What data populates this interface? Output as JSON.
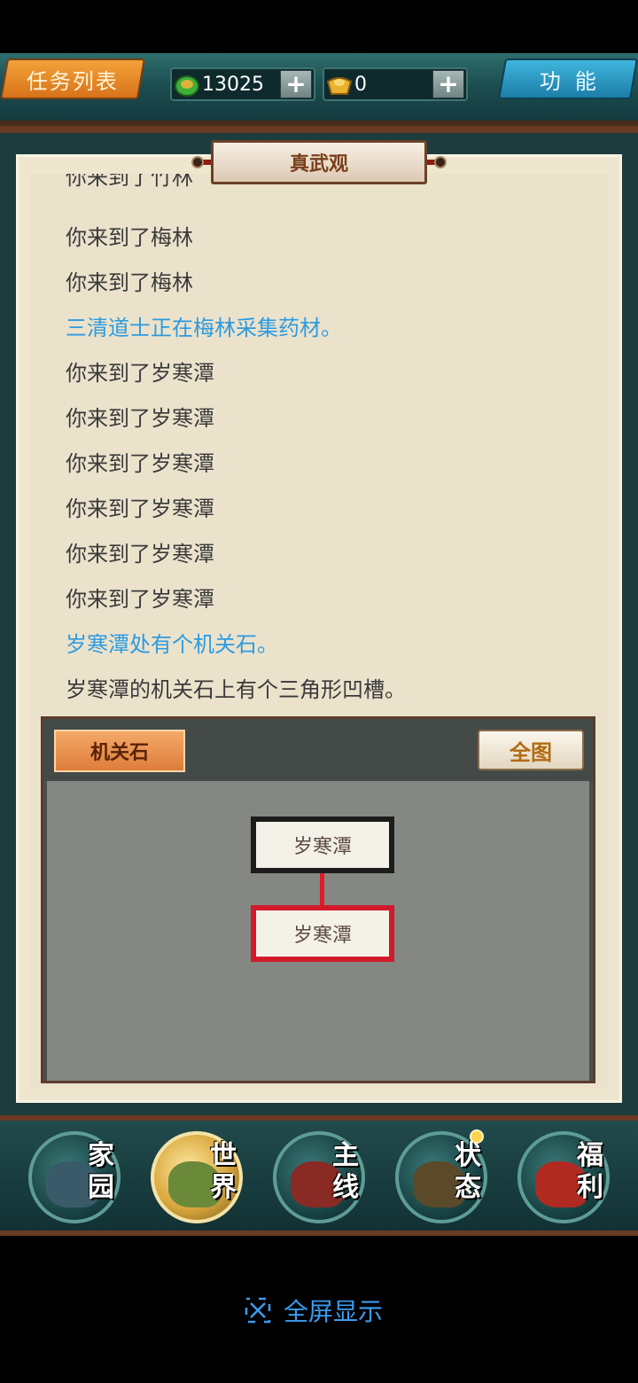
{
  "topbar": {
    "task_label": "任务列表",
    "gold_value": "13025",
    "ingot_value": "0",
    "plus_label": "+",
    "function_label": "功能",
    "gold_icon": "jade-coin-icon",
    "ingot_icon": "gold-ingot-icon"
  },
  "panel": {
    "title": "真武观"
  },
  "log": {
    "lines": [
      {
        "text": "你来到了竹林",
        "color": "#3a3a3a"
      },
      {
        "text": "你来到了梅林",
        "color": "#3a3a3a"
      },
      {
        "text": "你来到了梅林",
        "color": "#3a3a3a"
      },
      {
        "text": "三清道士正在梅林采集药材。",
        "color": "#2c9be0"
      },
      {
        "text": "你来到了岁寒潭",
        "color": "#3a3a3a"
      },
      {
        "text": "你来到了岁寒潭",
        "color": "#3a3a3a"
      },
      {
        "text": "你来到了岁寒潭",
        "color": "#3a3a3a"
      },
      {
        "text": "你来到了岁寒潭",
        "color": "#3a3a3a"
      },
      {
        "text": "你来到了岁寒潭",
        "color": "#3a3a3a"
      },
      {
        "text": "你来到了岁寒潭",
        "color": "#3a3a3a"
      },
      {
        "text": "岁寒潭处有个机关石。",
        "color": "#2c9be0"
      },
      {
        "text": "岁寒潭的机关石上有个三角形凹槽。",
        "color": "#3a3a3a"
      }
    ]
  },
  "map": {
    "location_label": "机关石",
    "full_map_label": "全图",
    "node_upper": "岁寒潭",
    "node_current": "岁寒潭"
  },
  "nav": {
    "home": "家园",
    "world": "世界",
    "main_quest": "主线",
    "status": "状态",
    "welfare": "福利"
  },
  "fullscreen": {
    "label": "全屏显示"
  }
}
